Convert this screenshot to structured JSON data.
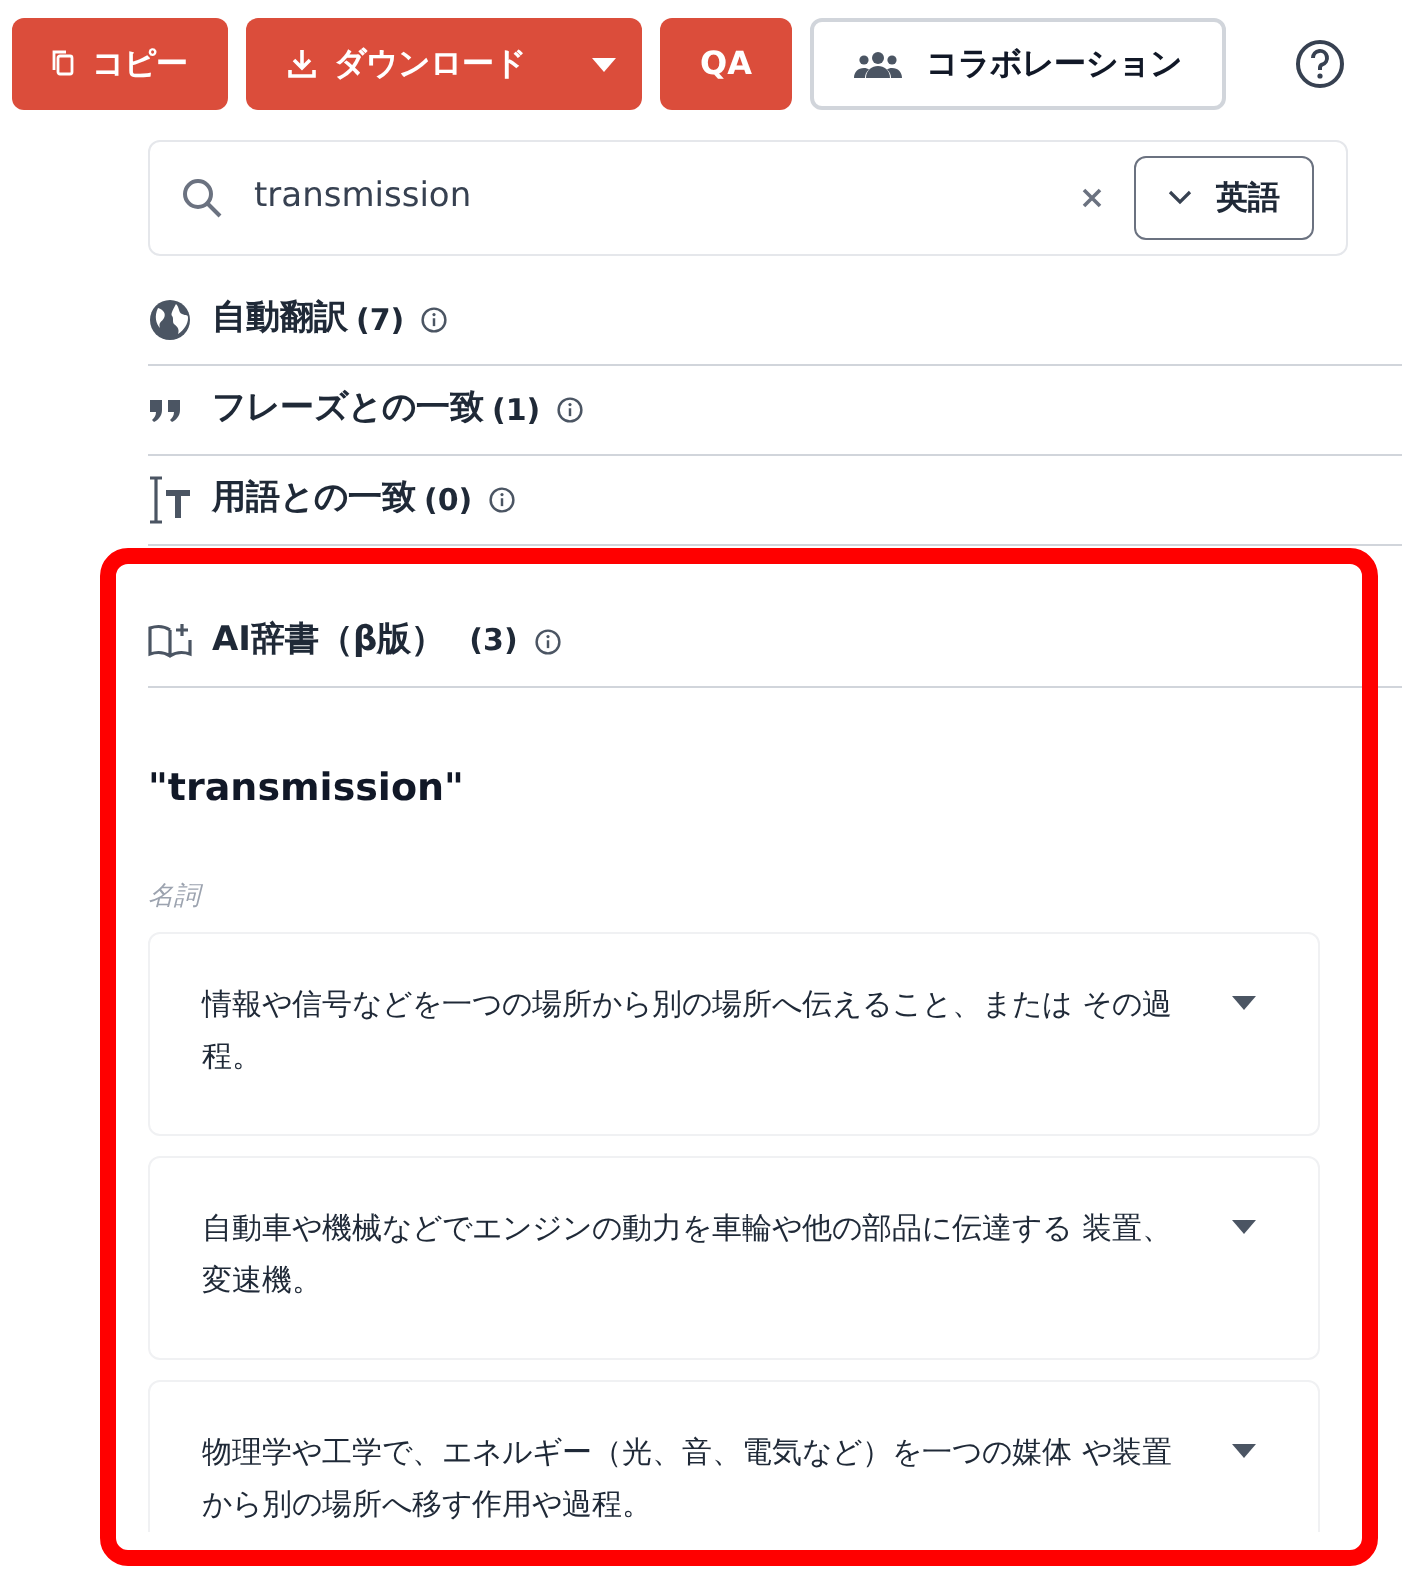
{
  "toolbar": {
    "buttons": [
      {
        "kind": "copy",
        "label": "コピー"
      },
      {
        "kind": "download",
        "label": "ダウンロード"
      },
      {
        "kind": "plain",
        "label": "QA"
      },
      {
        "kind": "collab",
        "label": "コラボレーション"
      }
    ]
  },
  "search": {
    "value": "transmission",
    "language": "英語"
  },
  "sections": [
    {
      "kind": "globe",
      "label": "自動翻訳",
      "count": "(7)"
    },
    {
      "kind": "quote",
      "label": "フレーズとの一致",
      "count": "(1)"
    },
    {
      "kind": "term",
      "label": "用語との一致",
      "count": "(0)"
    }
  ],
  "ai_dictionary": {
    "label": "AI辞書（β版）",
    "count": "(3)",
    "term": "\"transmission\"",
    "part_of_speech": "名詞",
    "definitions": [
      {
        "text": "情報や信号などを一つの場所から別の場所へ伝えること、または その過程。",
        "expanded": false
      },
      {
        "text": "自動車や機械などでエンジンの動力を車輪や他の部品に伝達する 装置、変速機。",
        "expanded": false
      },
      {
        "text": "物理学や工学で、エネルギー（光、音、電気など）を一つの媒体 や装置から別の場所へ移す作用や過程。",
        "expanded": false
      }
    ]
  }
}
